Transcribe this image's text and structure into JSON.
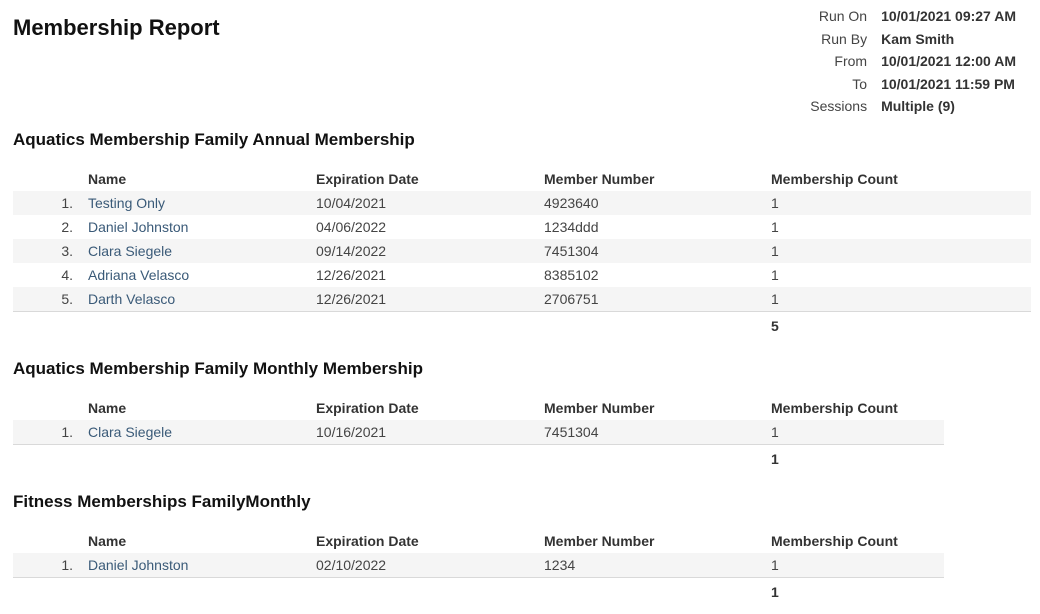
{
  "report": {
    "title": "Membership Report",
    "meta": [
      {
        "label": "Run On",
        "value": "10/01/2021 09:27 AM"
      },
      {
        "label": "Run By",
        "value": "Kam Smith"
      },
      {
        "label": "From",
        "value": "10/01/2021 12:00 AM"
      },
      {
        "label": "To",
        "value": "10/01/2021 11:59 PM"
      },
      {
        "label": "Sessions",
        "value": "Multiple (9)"
      }
    ],
    "columns": {
      "name": "Name",
      "expiration": "Expiration Date",
      "member_number": "Member Number",
      "count": "Membership Count"
    },
    "sections": [
      {
        "title": "Aquatics Membership Family Annual Membership",
        "total": "5",
        "rows": [
          {
            "idx": "1.",
            "name": "Testing Only",
            "expiration": "10/04/2021",
            "member_number": "4923640",
            "count": "1"
          },
          {
            "idx": "2.",
            "name": "Daniel Johnston",
            "expiration": "04/06/2022",
            "member_number": "1234ddd",
            "count": "1"
          },
          {
            "idx": "3.",
            "name": "Clara Siegele",
            "expiration": "09/14/2022",
            "member_number": "7451304",
            "count": "1"
          },
          {
            "idx": "4.",
            "name": "Adriana Velasco",
            "expiration": "12/26/2021",
            "member_number": "8385102",
            "count": "1"
          },
          {
            "idx": "5.",
            "name": "Darth Velasco",
            "expiration": "12/26/2021",
            "member_number": "2706751",
            "count": "1"
          }
        ]
      },
      {
        "title": "Aquatics Membership Family Monthly Membership",
        "total": "1",
        "rows": [
          {
            "idx": "1.",
            "name": "Clara Siegele",
            "expiration": "10/16/2021",
            "member_number": "7451304",
            "count": "1"
          }
        ]
      },
      {
        "title": "Fitness Memberships FamilyMonthly",
        "total": "1",
        "rows": [
          {
            "idx": "1.",
            "name": "Daniel Johnston",
            "expiration": "02/10/2022",
            "member_number": "1234",
            "count": "1"
          }
        ]
      }
    ]
  }
}
